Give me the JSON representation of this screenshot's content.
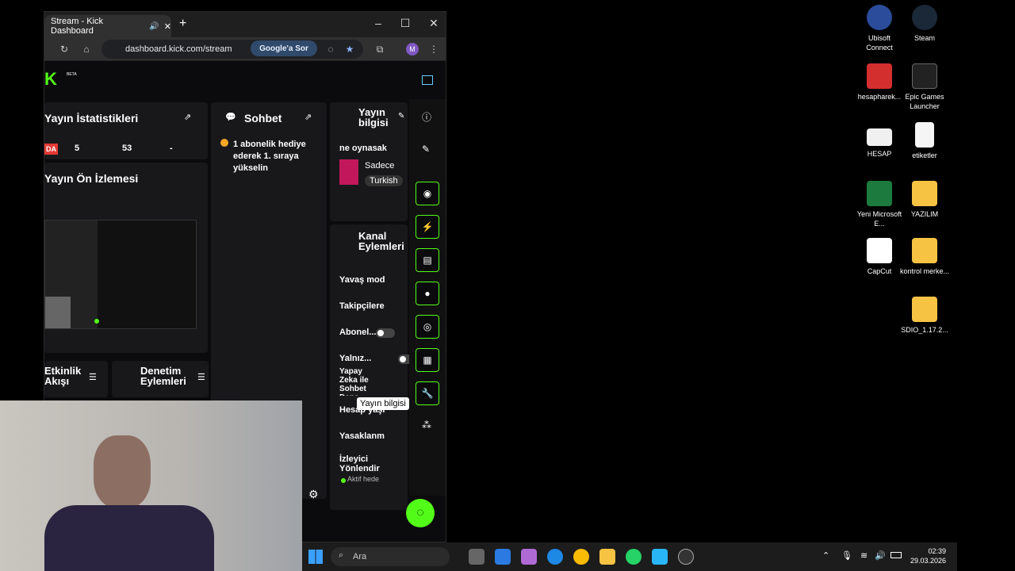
{
  "browser": {
    "tab_title": "Stream - Kick Dashboard",
    "url": "dashboard.kick.com/stream",
    "google_btn": "Google'a Sor",
    "profile_initial": "M"
  },
  "kick": {
    "logo": "K",
    "beta": "BETA",
    "stats": {
      "title": "Yayın İstatistikleri",
      "badge": "DA",
      "v1": "5",
      "v2": "53",
      "v3": "-"
    },
    "preview_title": "Yayın Ön İzlemesi",
    "chat": {
      "title": "Sohbet",
      "msg": "1 abonelik hediye ederek 1. sıraya yükselin"
    },
    "info": {
      "title": "Yayın bilgisi",
      "stream_title": "ne oynasak",
      "cat": "Sadece",
      "lang": "Turkish"
    },
    "actions": {
      "title": "Kanal Eylemleri",
      "items": [
        "Yavaş mod",
        "Takipçilere",
        "Abonel...",
        "Yalnız...",
        "Yapay Zeka ile Sohbet Dene",
        "Hesap yaşı",
        "Yasaklanm",
        "İzleyici Yönlendir",
        "Aktif hede"
      ]
    },
    "activity": "Etkinlik Akışı",
    "moderation": "Denetim Eylemleri",
    "tooltip": "Yayın bilgisi"
  },
  "desktop": [
    {
      "label": "Ubisoft Connect",
      "color": "#2b4c9b"
    },
    {
      "label": "Steam",
      "color": "#1b2838"
    },
    {
      "label": "hesapharek...",
      "color": "#d32f2f"
    },
    {
      "label": "Epic Games Launcher",
      "color": "#222"
    },
    {
      "label": "HESAP",
      "color": "#f0f0f0"
    },
    {
      "label": "etiketler",
      "color": "#f5f5f5"
    },
    {
      "label": "Yeni Microsoft E...",
      "color": "#1d7a3e"
    },
    {
      "label": "YAZILIM",
      "color": "#f6c343"
    },
    {
      "label": "CapCut",
      "color": "#ffffff"
    },
    {
      "label": "kontrol merke...",
      "color": "#f6c343"
    },
    {
      "label": "SDIO_1.17.2...",
      "color": "#f6c343"
    }
  ],
  "taskbar": {
    "search": "Ara",
    "time": "02:39",
    "date": "29.03.2026"
  }
}
